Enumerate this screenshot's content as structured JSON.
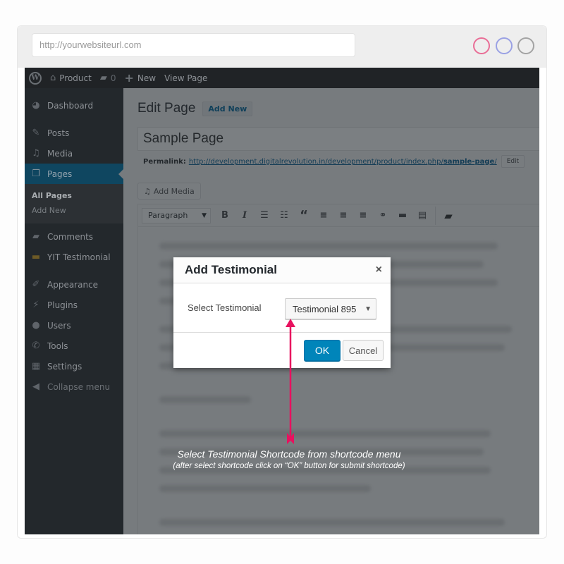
{
  "browser": {
    "url": "http://yourwebsiteurl.com",
    "window_dots": [
      "#e96d96",
      "#9aa1e4",
      "#a3a3a3"
    ]
  },
  "adminbar": {
    "site_name": "Product",
    "comments_count": "0",
    "new_label": "New",
    "view_page_label": "View Page"
  },
  "sidebar": {
    "items": [
      {
        "label": "Dashboard",
        "icon": "dashboard-icon"
      },
      {
        "label": "Posts",
        "icon": "pin-icon"
      },
      {
        "label": "Media",
        "icon": "media-icon"
      },
      {
        "label": "Pages",
        "icon": "pages-icon",
        "active": true
      },
      {
        "label": "Comments",
        "icon": "comment-icon"
      },
      {
        "label": "YIT Testimonial",
        "icon": "testimonial-icon"
      },
      {
        "label": "Appearance",
        "icon": "brush-icon"
      },
      {
        "label": "Plugins",
        "icon": "plug-icon"
      },
      {
        "label": "Users",
        "icon": "user-icon"
      },
      {
        "label": "Tools",
        "icon": "wrench-icon"
      },
      {
        "label": "Settings",
        "icon": "settings-icon"
      },
      {
        "label": "Collapse menu",
        "icon": "collapse-icon"
      }
    ],
    "submenu": [
      {
        "label": "All Pages",
        "current": true
      },
      {
        "label": "Add New"
      }
    ]
  },
  "editor": {
    "heading": "Edit Page",
    "add_new_label": "Add New",
    "title_value": "Sample Page",
    "permalink_label": "Permalink:",
    "permalink_base": "http://development.digitalrevolution.in/development/product/index.php/",
    "permalink_slug": "sample-page",
    "permalink_trailing": "/",
    "edit_label": "Edit",
    "add_media_label": "Add Media",
    "format_select": "Paragraph",
    "toolbar": [
      "bold",
      "italic",
      "bulleted-list",
      "numbered-list",
      "blockquote",
      "align-left",
      "align-center",
      "align-right",
      "link",
      "read-more",
      "toolbar-toggle",
      "testimonial-shortcode"
    ]
  },
  "modal": {
    "title": "Add Testimonial",
    "close_icon": "×",
    "field_label": "Select Testimonial",
    "selected_value": "Testimonial 895",
    "ok_label": "OK",
    "cancel_label": "Cancel"
  },
  "annotation": {
    "line1": "Select Testimonial Shortcode from shortcode menu",
    "line2": "(after select shortcode click on “OK” button for submit shortcode)",
    "arrow_color": "#e8115f"
  }
}
